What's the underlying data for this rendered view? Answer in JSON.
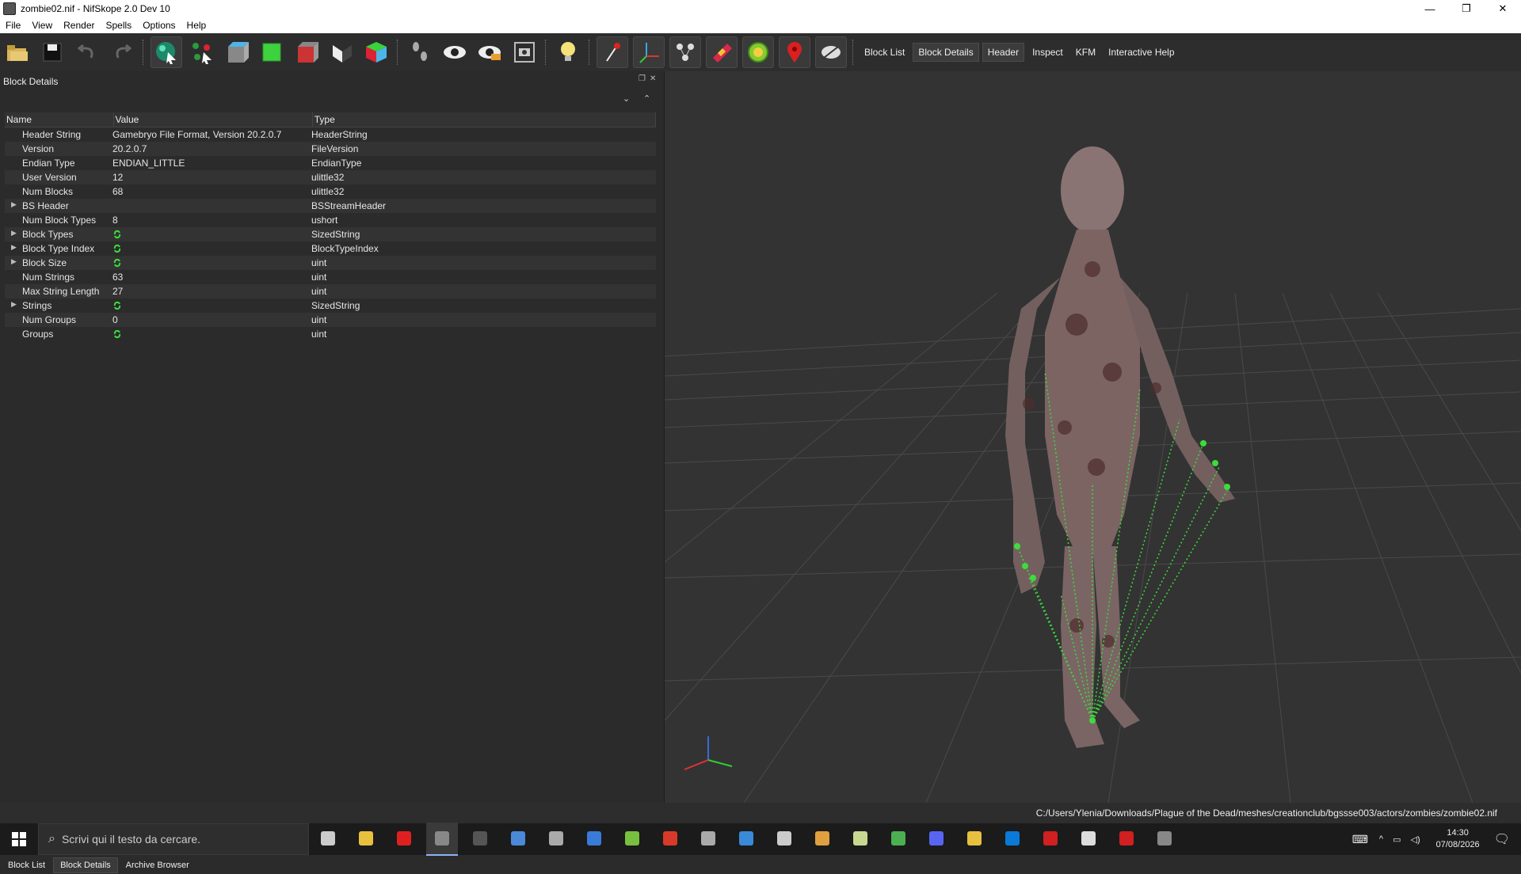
{
  "window": {
    "title": "zombie02.nif - NifSkope 2.0 Dev 10",
    "minimize": "—",
    "maximize": "❐",
    "close": "✕"
  },
  "menu": [
    "File",
    "View",
    "Render",
    "Spells",
    "Options",
    "Help"
  ],
  "toolbar": {
    "icons": [
      "open-icon",
      "save-icon",
      "undo-icon",
      "redo-icon",
      "select-object-icon",
      "select-vertex-icon",
      "view-front-icon",
      "view-top-icon",
      "view-side-icon",
      "view-user-icon",
      "view-perspective-icon",
      "walk-icon",
      "eye-icon",
      "eye-toggle-icon",
      "screenshot-icon",
      "light-icon",
      "pin-icon",
      "axes-icon",
      "nodes-icon",
      "havok-icon",
      "textures-icon",
      "marker-icon",
      "hidden-icon"
    ],
    "tabs": [
      "Block List",
      "Block Details",
      "Header",
      "Inspect",
      "KFM",
      "Interactive Help"
    ],
    "active_tab": "Block Details"
  },
  "panel": {
    "title": "Block Details",
    "columns": [
      "Name",
      "Value",
      "Type"
    ],
    "rows": [
      {
        "name": "Header String",
        "value": "Gamebryo File Format, Version 20.2.0.7",
        "type": "HeaderString",
        "expandable": false,
        "link": false
      },
      {
        "name": "Version",
        "value": "20.2.0.7",
        "type": "FileVersion",
        "expandable": false,
        "link": false
      },
      {
        "name": "Endian Type",
        "value": "ENDIAN_LITTLE",
        "type": "EndianType",
        "expandable": false,
        "link": false
      },
      {
        "name": "User Version",
        "value": "12",
        "type": "ulittle32",
        "expandable": false,
        "link": false
      },
      {
        "name": "Num Blocks",
        "value": "68",
        "type": "ulittle32",
        "expandable": false,
        "link": false
      },
      {
        "name": "BS Header",
        "value": "",
        "type": "BSStreamHeader",
        "expandable": true,
        "link": false
      },
      {
        "name": "Num Block Types",
        "value": "8",
        "type": "ushort",
        "expandable": false,
        "link": false
      },
      {
        "name": "Block Types",
        "value": "",
        "type": "SizedString",
        "expandable": true,
        "link": true
      },
      {
        "name": "Block Type Index",
        "value": "",
        "type": "BlockTypeIndex",
        "expandable": true,
        "link": true
      },
      {
        "name": "Block Size",
        "value": "",
        "type": "uint",
        "expandable": true,
        "link": true
      },
      {
        "name": "Num Strings",
        "value": "63",
        "type": "uint",
        "expandable": false,
        "link": false
      },
      {
        "name": "Max String Length",
        "value": "27",
        "type": "uint",
        "expandable": false,
        "link": false
      },
      {
        "name": "Strings",
        "value": "",
        "type": "SizedString",
        "expandable": true,
        "link": true
      },
      {
        "name": "Num Groups",
        "value": "0",
        "type": "uint",
        "expandable": false,
        "link": false
      },
      {
        "name": "Groups",
        "value": "",
        "type": "uint",
        "expandable": false,
        "link": true
      }
    ],
    "bottom_tabs": [
      "Block List",
      "Block Details",
      "Archive Browser"
    ],
    "active_bottom_tab": "Block Details"
  },
  "status": {
    "path": "C:/Users/Ylenia/Downloads/Plague of the Dead/meshes/creationclub/bgssse003/actors/zombies/zombie02.nif"
  },
  "taskbar": {
    "search_placeholder": "Scrivi qui il testo da cercare.",
    "time": "14:30",
    "date": "07/08/2026",
    "apps": [
      "task-view-icon",
      "file-explorer-icon",
      "opera-icon",
      "nifskope-icon",
      "terminal-icon",
      "pen-icon",
      "game-icon",
      "store-icon",
      "notepad-icon",
      "filezilla-icon",
      "arrow-icon",
      "window-icon",
      "calendar-icon",
      "creature-icon",
      "folder-map-icon",
      "chrome-icon",
      "discord-icon",
      "folder-icon",
      "vscode-icon",
      "tool-icon",
      "grid-icon",
      "record-icon",
      "settings-icon"
    ]
  },
  "colors": {
    "accent_green": "#3cdc3c",
    "panel_bg": "#2b2b2b",
    "viewport_bg": "#333333"
  }
}
